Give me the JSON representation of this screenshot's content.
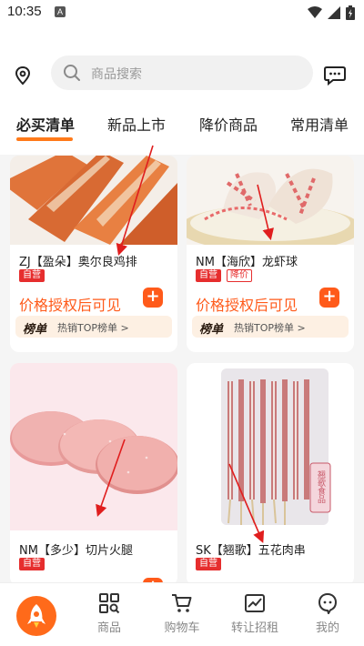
{
  "status": {
    "time": "10:35",
    "notif_letter": "A"
  },
  "header": {
    "search_placeholder": "商品搜索"
  },
  "tabs": [
    {
      "label": "必买清单",
      "active": true
    },
    {
      "label": "新品上市",
      "active": false
    },
    {
      "label": "降价商品",
      "active": false
    },
    {
      "label": "常用清单",
      "active": false
    }
  ],
  "products": [
    {
      "name": "ZJ【盈朵】奥尔良鸡排",
      "tags": [
        "自营"
      ],
      "price_text": "价格授权后可见",
      "rank_label": "榜单",
      "rank_text": "热销TOP榜单 >"
    },
    {
      "name": "NM【海欣】龙虾球",
      "tags": [
        "自营",
        "降价"
      ],
      "price_text": "价格授权后可见",
      "rank_label": "榜单",
      "rank_text": "热销TOP榜单 >"
    },
    {
      "name": "NM【多少】切片火腿",
      "tags": [
        "自营"
      ]
    },
    {
      "name": "SK【翘歌】五花肉串",
      "tags": [
        "自营"
      ],
      "package_stamp": "翘歌食品"
    }
  ],
  "bottom_nav": [
    {
      "label": "商品",
      "icon": "grid-search-icon"
    },
    {
      "label": "购物车",
      "icon": "cart-icon"
    },
    {
      "label": "转让招租",
      "icon": "chart-icon"
    },
    {
      "label": "我的",
      "icon": "profile-icon"
    }
  ],
  "colors": {
    "accent": "#ff5a1a",
    "tag_red": "#e62e2e",
    "rank_bg": "#fdf0e3"
  }
}
